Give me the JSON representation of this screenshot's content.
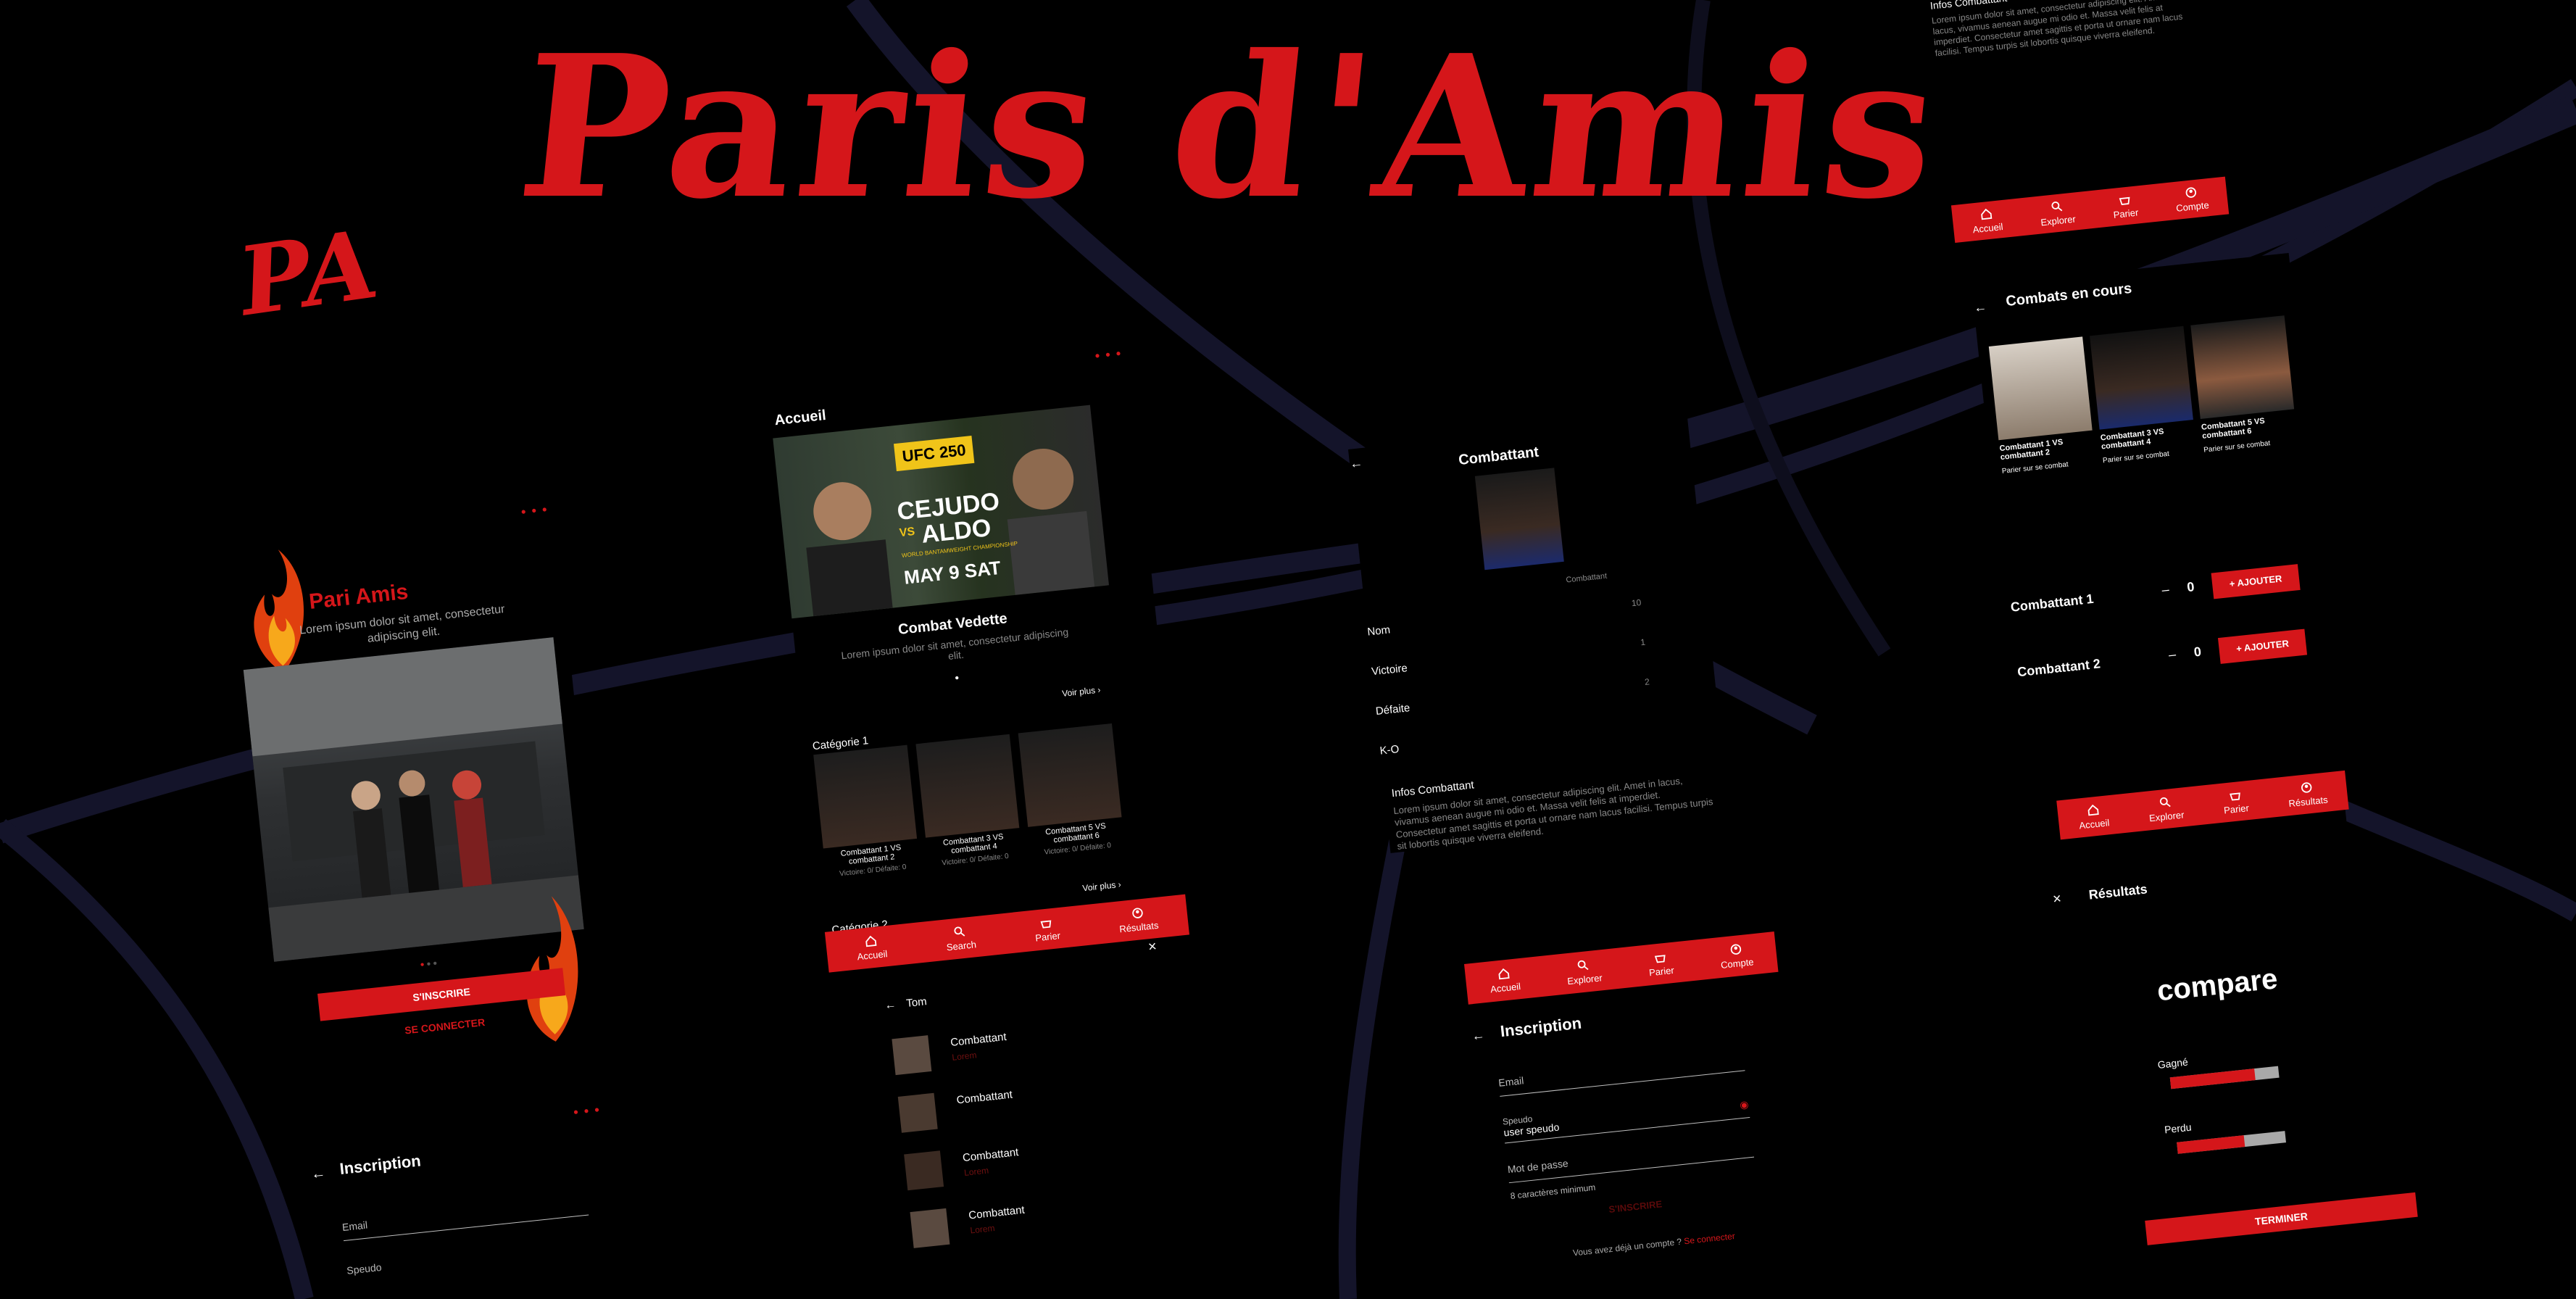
{
  "brand": {
    "title": "Paris d'Amis",
    "logo": "PA",
    "accent": "#d5161a"
  },
  "welcome": {
    "app_name": "Pari Amis",
    "tagline": "Lorem ipsum dolor sit amet, consectetur adipiscing elit.",
    "signup": "S'INSCRIRE",
    "login": "SE CONNECTER"
  },
  "inscription_small": {
    "title": "Inscription",
    "email": "Email",
    "pseudo": "Speudo"
  },
  "home": {
    "title": "Accueil",
    "poster": {
      "event": "UFC 250",
      "fighter1": "CEJUDO",
      "vs": "VS",
      "fighter2": "ALDO",
      "subtitle": "WORLD BANTAMWEIGHT CHAMPIONSHIP",
      "date": "MAY 9 SAT"
    },
    "featured_title": "Combat Vedette",
    "featured_text": "Lorem ipsum dolor sit amet, consectetur adipiscing elit.",
    "category1": "Catégorie 1",
    "see_more": "Voir plus",
    "cards": [
      {
        "title": "Combattant 1 VS combattant 2",
        "stats": "Victoire: 0/ Défaite: 0"
      },
      {
        "title": "Combattant 3 VS combattant 4",
        "stats": "Victoire: 0/ Défaite: 0"
      },
      {
        "title": "Combattant 5 VS combattant 6",
        "stats": "Victoire: 0/ Défaite: 0"
      }
    ],
    "see_more2": "Voir plus",
    "category2": "Catégorie 2",
    "nav": [
      "Accueil",
      "Search",
      "Parier",
      "Résultats"
    ]
  },
  "search": {
    "query": "Tom",
    "results": [
      {
        "name": "Combattant",
        "sub": "Lorem"
      },
      {
        "name": "Combattant",
        "sub": ""
      },
      {
        "name": "Combattant",
        "sub": "Lorem"
      },
      {
        "name": "Combattant",
        "sub": "Lorem"
      }
    ]
  },
  "fighter": {
    "title": "Combattant",
    "col_label": "Combattant",
    "rows": [
      {
        "label": "Nom",
        "value": "10"
      },
      {
        "label": "Victoire",
        "value": "1"
      },
      {
        "label": "Défaite",
        "value": "2"
      },
      {
        "label": "K-O",
        "value": ""
      }
    ],
    "info_title": "Infos Combattant",
    "info_text": "Lorem ipsum dolor sit amet, consectetur adipiscing elit. Amet in lacus, vivamus aenean augue mi odio et. Massa velit felis at imperdiet. Consectetur amet sagittis et porta ut ornare nam lacus facilisi. Tempus turpis sit lobortis quisque viverra eleifend."
  },
  "inscription": {
    "nav": [
      "Accueil",
      "Explorer",
      "Parier",
      "Compte"
    ],
    "title": "Inscription",
    "email": "Email",
    "pseudo": "Speudo",
    "pseudo_value": "user speudo",
    "password": "Mot de passe",
    "hint": "8 caractères minimum",
    "submit": "S'INSCRIRE",
    "already": "Vous avez déjà un compte ?",
    "login": "Se connecter"
  },
  "topright": {
    "info_title": "Infos Combattant",
    "info_text": "Lorem ipsum dolor sit amet, consectetur adipiscing elit. Amet in lacus, vivamus aenean augue mi odio et. Massa velit felis at imperdiet. Consectetur amet sagittis et porta ut ornare nam lacus facilisi. Tempus turpis sit lobortis quisque viverra eleifend.",
    "nav": [
      "Accueil",
      "Explorer",
      "Parier",
      "Compte"
    ]
  },
  "live": {
    "title": "Combats en cours",
    "cards": [
      {
        "title": "Combattant 1 VS combattant 2",
        "cta": "Parier sur se combat"
      },
      {
        "title": "Combattant 3 VS combattant 4",
        "cta": "Parier sur se combat"
      },
      {
        "title": "Combattant 5 VS combattant 6",
        "cta": "Parier sur se combat"
      }
    ]
  },
  "bet": {
    "rows": [
      {
        "label": "Combattant 1",
        "minus": "–",
        "qty": "0",
        "btn": "AJOUTER"
      },
      {
        "label": "Combattant 2",
        "minus": "–",
        "qty": "0",
        "btn": "AJOUTER"
      }
    ],
    "nav": [
      "Accueil",
      "Explorer",
      "Parier",
      "Résultats"
    ]
  },
  "results": {
    "title": "Résultats",
    "compare": "compare",
    "won_label": "Gagné",
    "won_fraction": 0.78,
    "lost_label": "Perdu",
    "lost_fraction": 0.62,
    "finish": "TERMINER"
  }
}
